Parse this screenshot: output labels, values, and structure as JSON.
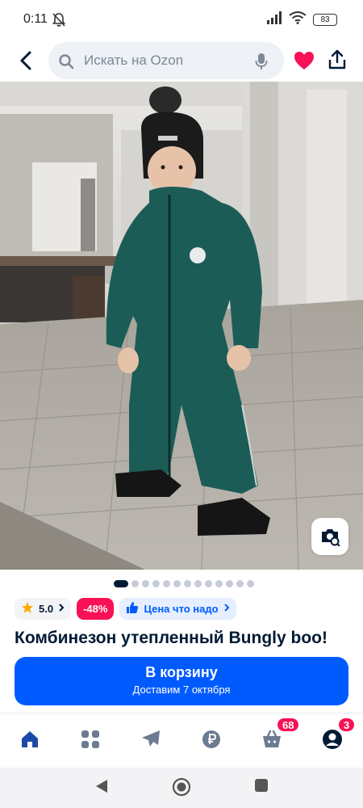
{
  "status_bar": {
    "time": "0:11",
    "battery": "83",
    "icons": [
      "mute-icon",
      "signal-icon",
      "wifi-icon",
      "battery-icon"
    ]
  },
  "header": {
    "search_placeholder": "Искать на Ozon",
    "icons": [
      "back-arrow-icon",
      "search-icon",
      "mic-icon",
      "heart-icon",
      "share-icon"
    ],
    "heart_color": "#f91155"
  },
  "gallery": {
    "total_images": 13,
    "active_index": 0,
    "similar_button_icon": "camera-search-icon"
  },
  "badges": {
    "rating": "5.0",
    "discount": "-48%",
    "price_label": "Цена что надо"
  },
  "product": {
    "title": "Комбинезон утепленный Bungly boo!"
  },
  "cart_button": {
    "label": "В корзину",
    "subtitle": "Доставим 7 октября",
    "color": "#005bff"
  },
  "tabbar": {
    "items": [
      {
        "icon": "home-icon"
      },
      {
        "icon": "catalog-icon"
      },
      {
        "icon": "airplane-icon"
      },
      {
        "icon": "ruble-icon"
      },
      {
        "icon": "basket-icon",
        "badge": "68"
      },
      {
        "icon": "profile-icon",
        "badge": "3"
      }
    ],
    "badge_color": "#f91155"
  },
  "system_nav": {
    "icons": [
      "back-triangle-icon",
      "home-circle-icon",
      "recents-square-icon"
    ]
  }
}
